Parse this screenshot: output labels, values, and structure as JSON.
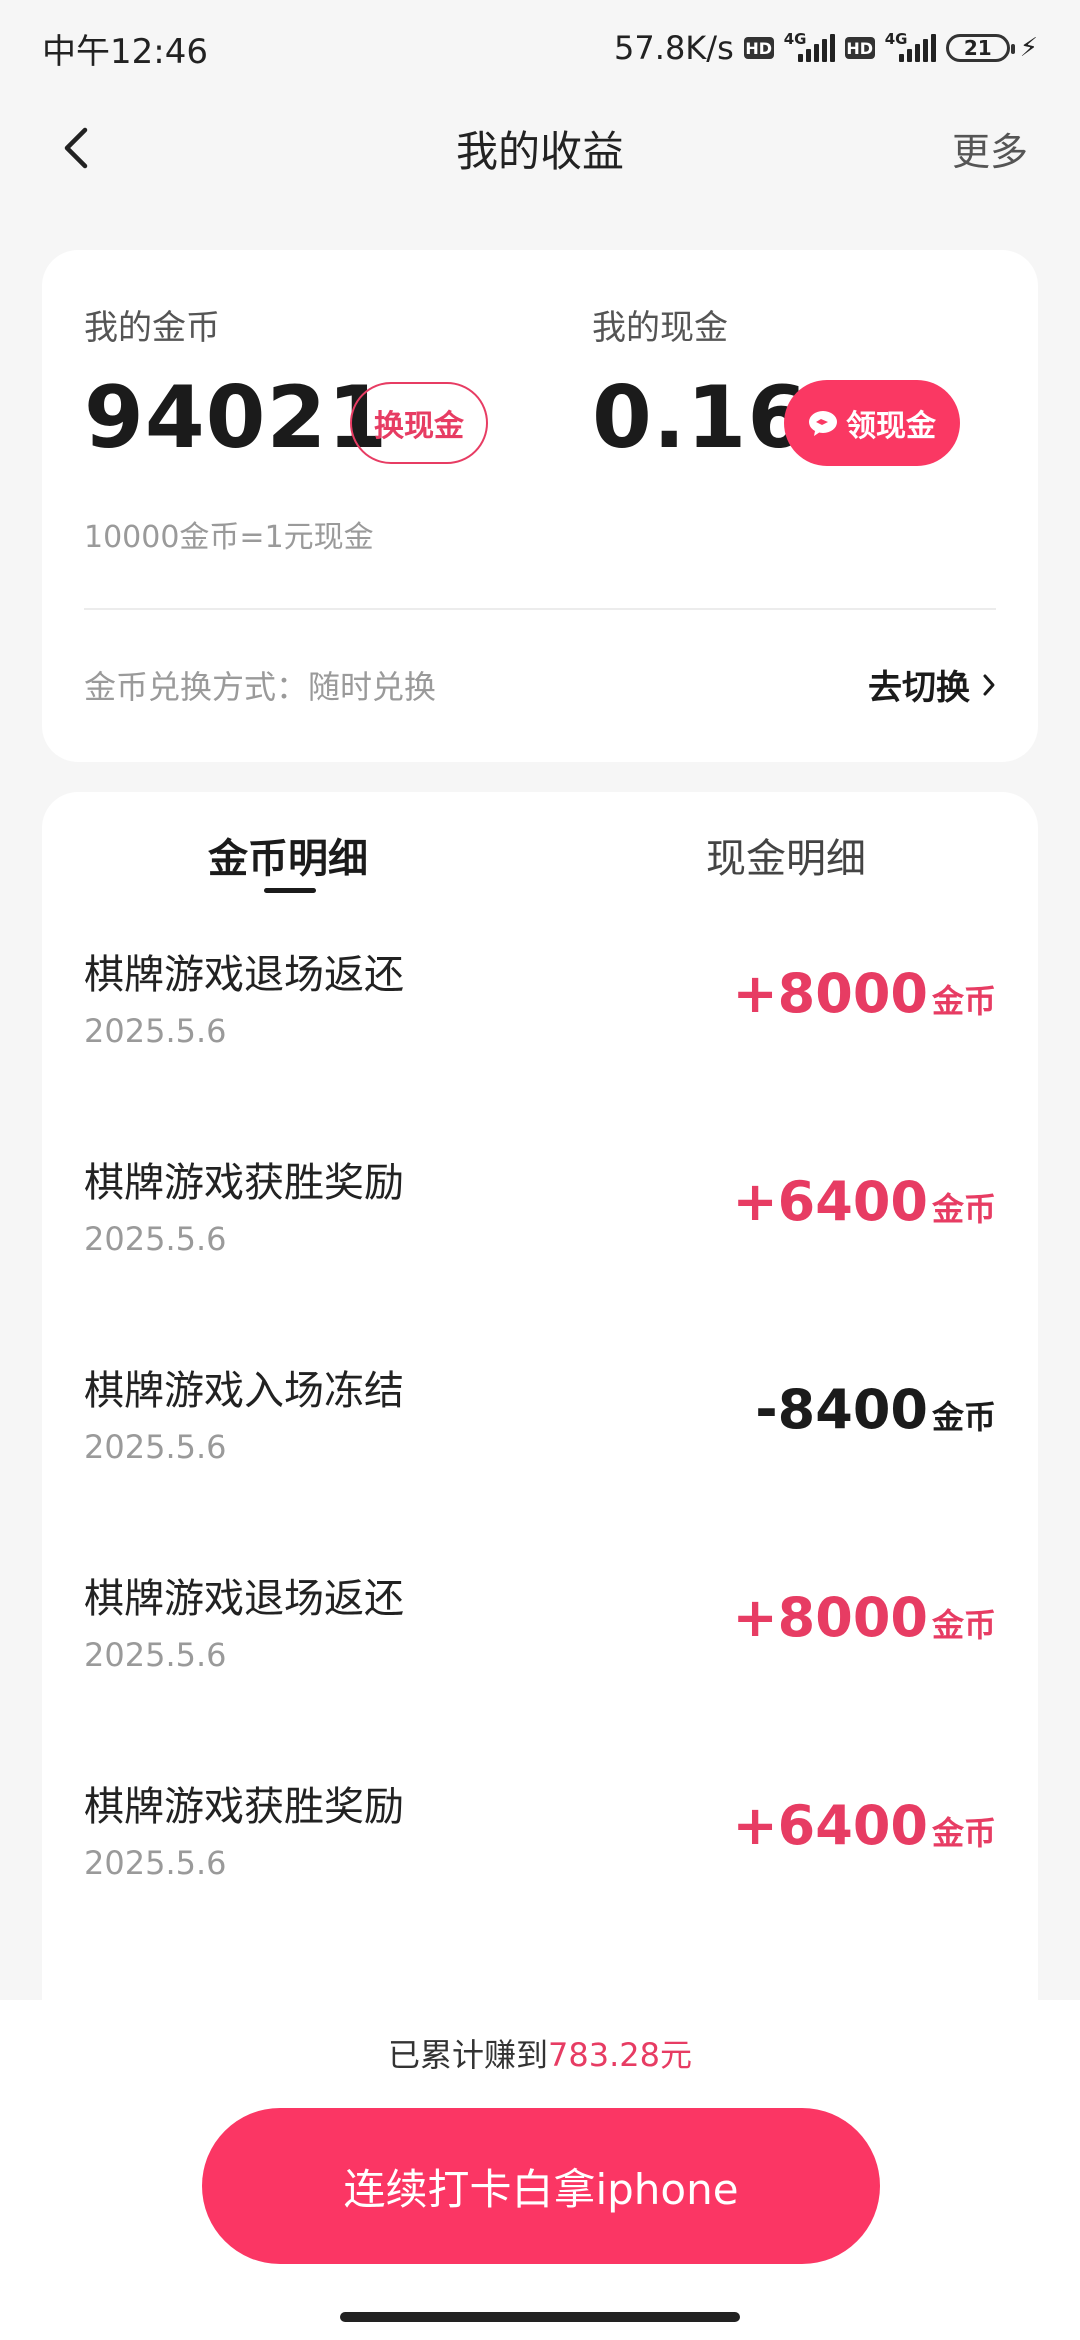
{
  "status_bar": {
    "time": "中午12:46",
    "net_speed": "57.8K/s",
    "hd1": "HD",
    "sig1_type": "4G",
    "hd2": "HD",
    "sig2_type": "4G",
    "battery": "21"
  },
  "header": {
    "title": "我的收益",
    "more": "更多"
  },
  "earnings": {
    "coins_label": "我的金币",
    "coins_value": "94021",
    "exchange_button": "换现金",
    "cash_label": "我的现金",
    "cash_value": "0.16",
    "withdraw_button": "领现金",
    "rate_note": "10000金币=1元现金",
    "method_text": "金币兑换方式：随时兑换",
    "switch_label": "去切换"
  },
  "tabs": [
    {
      "label": "金币明细",
      "active": true
    },
    {
      "label": "现金明细",
      "active": false
    }
  ],
  "records": [
    {
      "title": "棋牌游戏退场返还",
      "date": "2025.5.6",
      "amount": "+8000",
      "unit": "金币"
    },
    {
      "title": "棋牌游戏获胜奖励",
      "date": "2025.5.6",
      "amount": "+6400",
      "unit": "金币"
    },
    {
      "title": "棋牌游戏入场冻结",
      "date": "2025.5.6",
      "amount": "-8400",
      "unit": "金币"
    },
    {
      "title": "棋牌游戏退场返还",
      "date": "2025.5.6",
      "amount": "+8000",
      "unit": "金币"
    },
    {
      "title": "棋牌游戏获胜奖励",
      "date": "2025.5.6",
      "amount": "+6400",
      "unit": "金币"
    }
  ],
  "bottom": {
    "total_prefix": "已累计赚到",
    "total_amount": "783.28元",
    "checkin_button": "连续打卡白拿iphone"
  },
  "colors": {
    "accent": "#fa3863",
    "positive": "#e73c63",
    "background": "#f6f6f6"
  }
}
